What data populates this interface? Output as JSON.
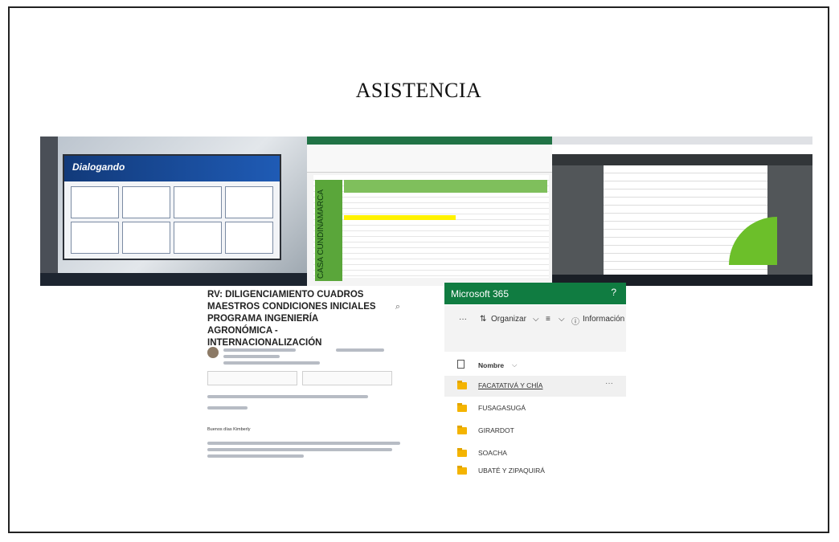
{
  "slide": {
    "title": "ASISTENCIA"
  },
  "photos": {
    "meeting_brand": "Dialogando",
    "sheet_side_label": "CASA CUNDINAMARCA"
  },
  "email": {
    "subject": "RV: DILIGENCIAMIENTO CUADROS MAESTROS CONDICIONES INICIALES PROGRAMA INGENIERÍA AGRONÓMICA - INTERNACIONALIZACIÓN",
    "zoom_icon": "zoom-icon",
    "greeting": "Buenos días Kimberly"
  },
  "ms365": {
    "brand": "Microsoft 365",
    "help": "?",
    "toolbar": {
      "more": "···",
      "organize": "Organizar",
      "view": "≡",
      "info": "Información"
    },
    "column_name": "Nombre",
    "folders": [
      {
        "name": "FACATATIVÁ Y CHÍA",
        "selected": true
      },
      {
        "name": "FUSAGASUGÁ",
        "selected": false
      },
      {
        "name": "GIRARDOT",
        "selected": false
      },
      {
        "name": "SOACHA",
        "selected": false
      },
      {
        "name": "UBATÉ Y ZIPAQUIRÁ",
        "selected": false
      }
    ],
    "row_more": "···"
  },
  "colors": {
    "ms_green": "#107c41",
    "folder": "#f4b400",
    "sheet_green": "#5aa63a"
  }
}
